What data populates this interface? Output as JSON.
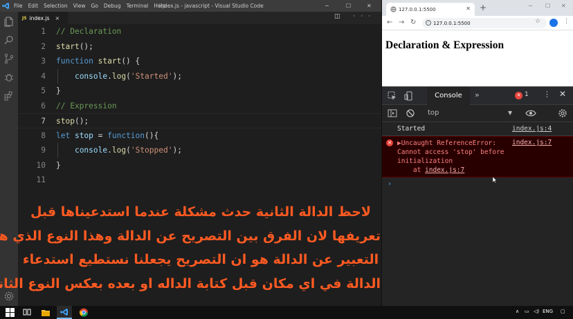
{
  "vscode": {
    "menu": [
      "File",
      "Edit",
      "Selection",
      "View",
      "Go",
      "Debug",
      "Terminal",
      "Help"
    ],
    "window_title": "index.js - javascript - Visual Studio Code",
    "tab": {
      "icon_text": "JS",
      "label": "index.js"
    },
    "lines": [
      {
        "n": "1",
        "tokens": [
          {
            "c": "cm",
            "t": "// Declaration"
          }
        ]
      },
      {
        "n": "2",
        "tokens": [
          {
            "c": "fn",
            "t": "start"
          },
          {
            "c": "pu",
            "t": "();"
          }
        ]
      },
      {
        "n": "3",
        "tokens": [
          {
            "c": "kw",
            "t": "function "
          },
          {
            "c": "fn",
            "t": "start"
          },
          {
            "c": "pu",
            "t": "() {"
          }
        ]
      },
      {
        "n": "4",
        "tokens": [
          {
            "c": "pu",
            "t": "    "
          },
          {
            "c": "vr",
            "t": "console"
          },
          {
            "c": "pu",
            "t": "."
          },
          {
            "c": "fn",
            "t": "log"
          },
          {
            "c": "pu",
            "t": "("
          },
          {
            "c": "st",
            "t": "'Started'"
          },
          {
            "c": "pu",
            "t": ");"
          }
        ]
      },
      {
        "n": "5",
        "tokens": [
          {
            "c": "pu",
            "t": "}"
          }
        ]
      },
      {
        "n": "6",
        "tokens": [
          {
            "c": "cm",
            "t": "// Expression"
          }
        ]
      },
      {
        "n": "7",
        "tokens": [
          {
            "c": "fn",
            "t": "stop"
          },
          {
            "c": "pu",
            "t": "();"
          }
        ]
      },
      {
        "n": "8",
        "tokens": [
          {
            "c": "kw",
            "t": "let "
          },
          {
            "c": "vr",
            "t": "stop"
          },
          {
            "c": "pu",
            "t": " = "
          },
          {
            "c": "kw",
            "t": "function"
          },
          {
            "c": "pu",
            "t": "(){"
          }
        ]
      },
      {
        "n": "9",
        "tokens": [
          {
            "c": "pu",
            "t": "    "
          },
          {
            "c": "vr",
            "t": "console"
          },
          {
            "c": "pu",
            "t": "."
          },
          {
            "c": "fn",
            "t": "log"
          },
          {
            "c": "pu",
            "t": "("
          },
          {
            "c": "st",
            "t": "'Stopped'"
          },
          {
            "c": "pu",
            "t": ");"
          }
        ]
      },
      {
        "n": "10",
        "tokens": [
          {
            "c": "pu",
            "t": "}"
          }
        ]
      },
      {
        "n": "11",
        "tokens": []
      }
    ],
    "current_line": "7",
    "caption": [
      "لاحظ  الدالة الثانية حدث مشكلة عندما استدعيناها قبل",
      "تعريفها لان الفرق بين التصريح عن الدالة وهذا النوع الذي هو",
      "التعبير عن الدالة هو ان التصريح يجعلنا نستطيع استدعاء",
      "الدالة في اي مكان قبل كتابة الداله او بعده بعكس النوع الثاني"
    ]
  },
  "browser": {
    "tab_title": "127.0.0.1:5500",
    "url": "127.0.0.1:5500",
    "page_heading": "Declaration & Expression",
    "devtools": {
      "active_tab": "Console",
      "error_count": "1",
      "context": "top",
      "logs": [
        {
          "text": "Started",
          "source": "index.js:4"
        }
      ],
      "error": {
        "line1": "▶Uncaught ReferenceError:",
        "line2": "Cannot access 'stop' before",
        "line3": "initialization",
        "at_prefix": "    at ",
        "at_link": "index.js:7",
        "source": "index.js:7"
      },
      "prompt": "›"
    }
  },
  "taskbar": {
    "lang": "ENG"
  },
  "colors": {
    "caption": "#ff5a22",
    "comment": "#6a9955",
    "keyword": "#569cd6",
    "function": "#dcdcaa",
    "string": "#ce9178",
    "error_bg": "#290000"
  }
}
